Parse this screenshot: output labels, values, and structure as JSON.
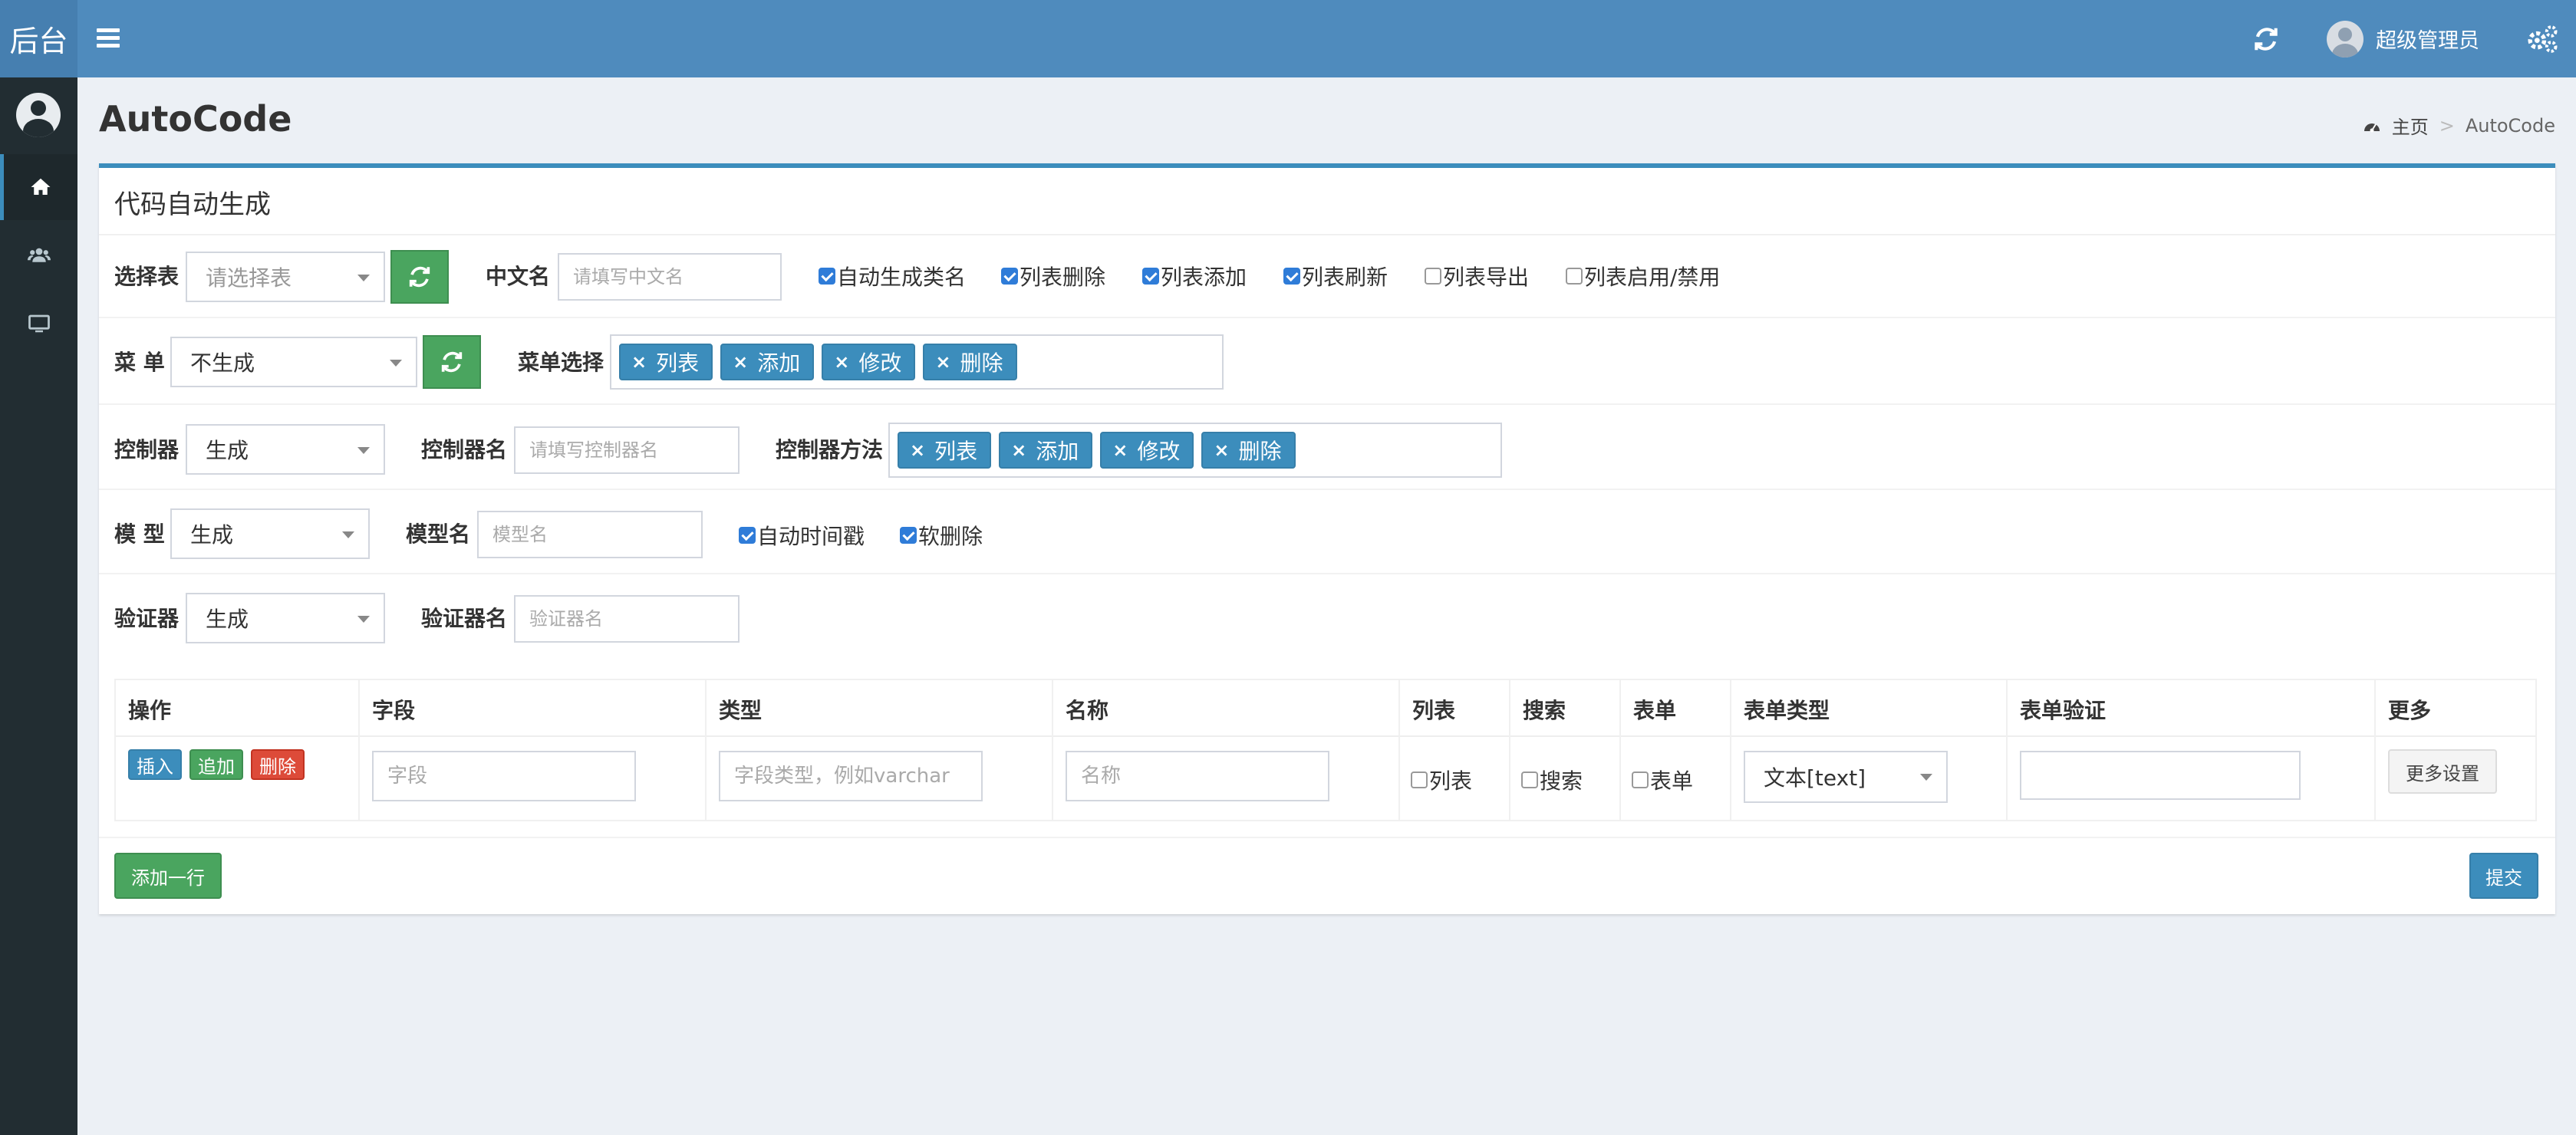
{
  "app": {
    "logo_text": "后台"
  },
  "topbar": {
    "user_name": "超级管理员"
  },
  "page": {
    "title": "AutoCode"
  },
  "breadcrumb": {
    "home": "主页",
    "separator": ">",
    "current": "AutoCode"
  },
  "box": {
    "title": "代码自动生成"
  },
  "form": {
    "table_label": "选择表",
    "table_select_placeholder": "请选择表",
    "cn_name_label": "中文名",
    "cn_name_placeholder": "请填写中文名",
    "options": [
      {
        "label": "自动生成类名",
        "checked": true
      },
      {
        "label": "列表删除",
        "checked": true
      },
      {
        "label": "列表添加",
        "checked": true
      },
      {
        "label": "列表刷新",
        "checked": true
      },
      {
        "label": "列表导出",
        "checked": false
      },
      {
        "label": "列表启用/禁用",
        "checked": false
      }
    ],
    "menu_label": "菜 单",
    "menu_select_value": "不生成",
    "menu_choose_label": "菜单选择",
    "menu_tags": [
      "列表",
      "添加",
      "修改",
      "删除"
    ],
    "controller_label": "控制器",
    "controller_select_value": "生成",
    "controller_name_label": "控制器名",
    "controller_name_placeholder": "请填写控制器名",
    "controller_method_label": "控制器方法",
    "controller_tags": [
      "列表",
      "添加",
      "修改",
      "删除"
    ],
    "model_label": "模 型",
    "model_select_value": "生成",
    "model_name_label": "模型名",
    "model_name_placeholder": "模型名",
    "model_options": [
      {
        "label": "自动时间戳",
        "checked": true
      },
      {
        "label": "软删除",
        "checked": true
      }
    ],
    "validator_label": "验证器",
    "validator_select_value": "生成",
    "validator_name_label": "验证器名",
    "validator_name_placeholder": "验证器名",
    "tag_remove_symbol": "×"
  },
  "fields_table": {
    "headers": [
      "操作",
      "字段",
      "类型",
      "名称",
      "列表",
      "搜索",
      "表单",
      "表单类型",
      "表单验证",
      "更多"
    ],
    "row": {
      "insert_label": "插入",
      "append_label": "追加",
      "delete_label": "删除",
      "field_placeholder": "字段",
      "type_placeholder": "字段类型，例如varchar",
      "name_placeholder": "名称",
      "list_label": "列表",
      "search_label": "搜索",
      "form_label": "表单",
      "form_type_value": "文本[text]",
      "more_label": "更多设置"
    }
  },
  "footer": {
    "add_row_label": "添加一行",
    "submit_label": "提交"
  },
  "colors": {
    "primary": "#3c8dbc",
    "topbar": "#4f8bbd",
    "sidebar": "#222d32",
    "success": "#4aa55f",
    "danger": "#dd4b39"
  },
  "icons": {
    "menu": "bars-icon",
    "refresh": "refresh-icon",
    "settings": "gears-icon",
    "home": "home-icon",
    "users": "users-icon",
    "desktop": "desktop-icon",
    "dashboard": "dashboard-icon"
  }
}
